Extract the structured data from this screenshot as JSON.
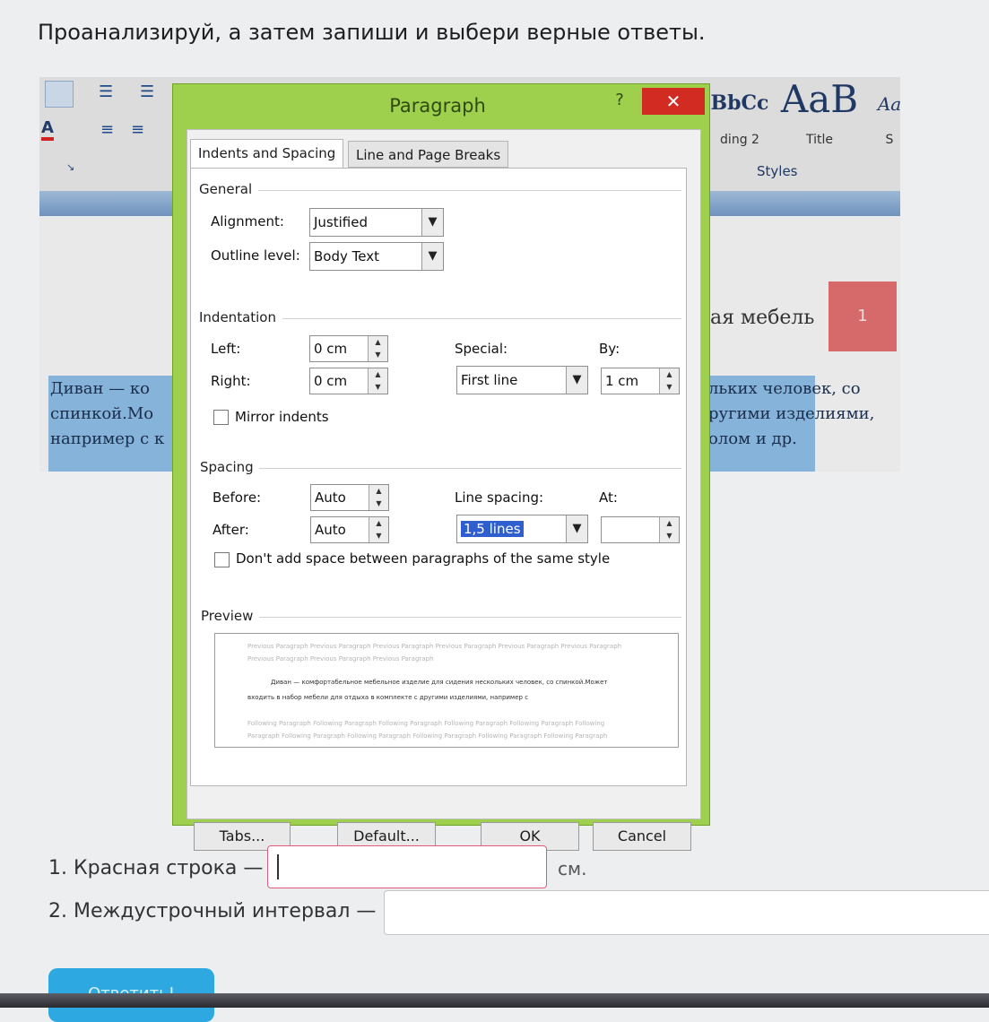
{
  "page": {
    "task_title": "Проанализируй, а затем запиши и выбери верные ответы."
  },
  "word_background": {
    "styles_tiles": [
      {
        "preview": "BbCc",
        "name": "ding 2"
      },
      {
        "preview": "AaB",
        "name": "Title"
      },
      {
        "preview": "Aa",
        "name": "S"
      }
    ],
    "styles_group_label": "Styles",
    "doc_word": "ая мебель",
    "badge_number": "1",
    "doc_lines": [
      {
        "left": "Диван — ко",
        "right": "льких человек, со"
      },
      {
        "left": "спинкой.Мо",
        "right": "ругими изделиями,"
      },
      {
        "left": "например с к",
        "right": "олом и др."
      }
    ]
  },
  "dialog": {
    "title": "Paragraph",
    "help_glyph": "?",
    "close_glyph": "✕",
    "tabs": [
      "Indents and Spacing",
      "Line and Page Breaks"
    ],
    "general": {
      "heading": "General",
      "alignment_label": "Alignment:",
      "alignment_value": "Justified",
      "outline_label": "Outline level:",
      "outline_value": "Body Text"
    },
    "indentation": {
      "heading": "Indentation",
      "left_label": "Left:",
      "left_value": "0 cm",
      "right_label": "Right:",
      "right_value": "0 cm",
      "special_label": "Special:",
      "special_value": "First line",
      "by_label": "By:",
      "by_value": "1 cm",
      "mirror_label": "Mirror indents"
    },
    "spacing": {
      "heading": "Spacing",
      "before_label": "Before:",
      "before_value": "Auto",
      "after_label": "After:",
      "after_value": "Auto",
      "line_spacing_label": "Line spacing:",
      "line_spacing_value": "1,5 lines",
      "at_label": "At:",
      "at_value": "",
      "dont_add_label": "Don't add space between paragraphs of the same style"
    },
    "preview": {
      "heading": "Preview",
      "prev_lines": [
        "Previous Paragraph Previous Paragraph Previous Paragraph Previous Paragraph Previous Paragraph Previous Paragraph",
        "Previous Paragraph Previous Paragraph Previous Paragraph"
      ],
      "sample_lines": [
        "Диван — комфортабельное мебельное изделие для сидения нескольких человек, со спинкой.Может",
        "входить в набор мебели для отдыха в комплекте с другими изделиями, например с"
      ],
      "next_lines": [
        "Following Paragraph Following Paragraph Following Paragraph Following Paragraph Following Paragraph Following",
        "Paragraph Following Paragraph Following Paragraph Following Paragraph Following Paragraph Following Paragraph"
      ]
    },
    "buttons": {
      "tabs": "Tabs...",
      "default": "Default...",
      "ok": "OK",
      "cancel": "Cancel"
    }
  },
  "form": {
    "q1_label": "1. Красная строка —",
    "q1_value": "",
    "q1_unit": "см.",
    "q2_label": "2. Междустрочный интервал —",
    "q2_value": "",
    "submit_label": "Ответить!"
  },
  "colors": {
    "dialog_frame": "#9ecf4d",
    "close_button": "#d12b22",
    "input_focus_border": "#e05a7a",
    "submit_button": "#2ea8e0"
  }
}
